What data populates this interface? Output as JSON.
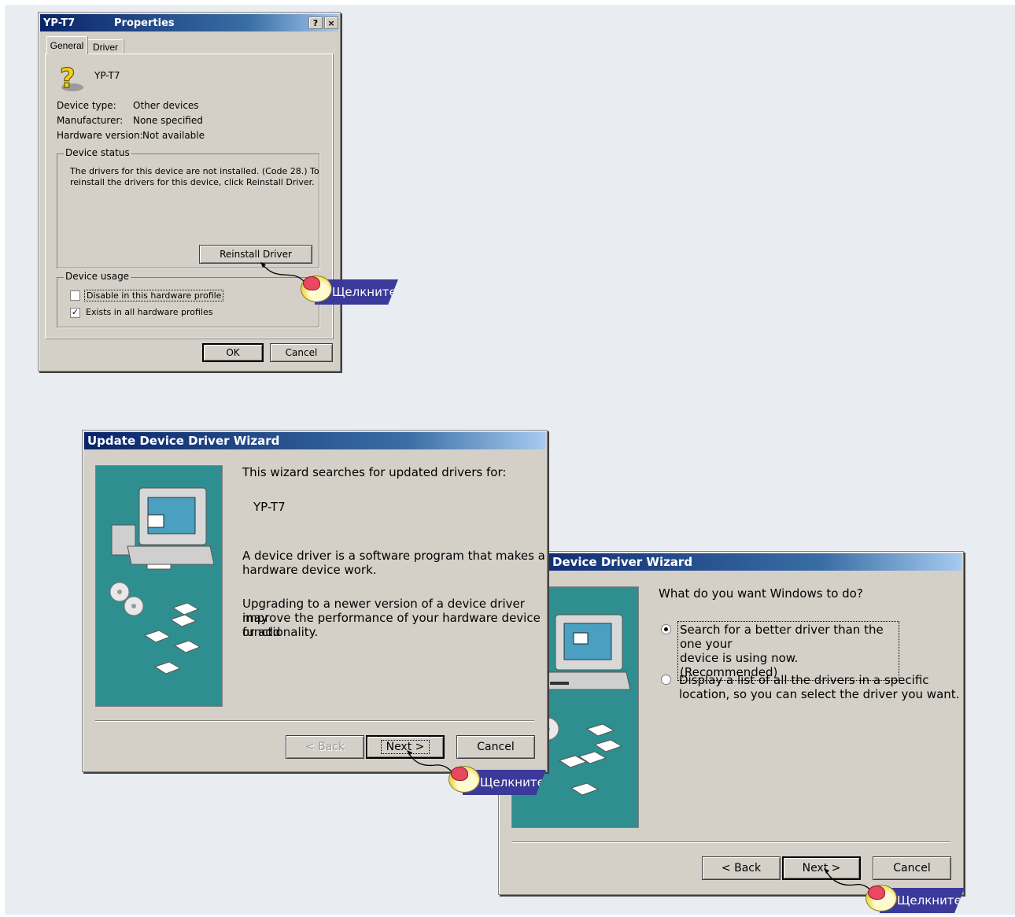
{
  "properties_dialog": {
    "title_left": "YP-T7",
    "title_right": "Properties",
    "help_btn": "?",
    "close_btn": "×",
    "tabs": [
      "General",
      "Driver"
    ],
    "device_name": "YP-T7",
    "rows": [
      {
        "label": "Device type:",
        "value": "Other devices"
      },
      {
        "label": "Manufacturer:",
        "value": "None specified"
      },
      {
        "label": "Hardware version:",
        "value": "Not available"
      }
    ],
    "status_group": "Device status",
    "status_text_1": "The drivers for this device are not installed. (Code 28.) To",
    "status_text_2": "reinstall the drivers for this device, click Reinstall Driver.",
    "reinstall_button": "Reinstall Driver",
    "usage_group": "Device usage",
    "usage_options": [
      {
        "label": "Disable in this hardware profile",
        "checked": false
      },
      {
        "label": "Exists in all hardware profiles",
        "checked": true
      }
    ],
    "ok_button": "OK",
    "cancel_button": "Cancel"
  },
  "wizard1": {
    "title": "Update Device Driver Wizard",
    "line1": "This wizard searches for updated drivers for:",
    "device": "YP-T7",
    "para1_a": "A device driver is a software program that makes a",
    "para1_b": "hardware device work.",
    "para2_a": "Upgrading to a newer version of a device driver may",
    "para2_b": "improve the performance of your hardware device or add",
    "para2_c": "functionality.",
    "back_button": "< Back",
    "next_button": "Next >",
    "cancel_button": "Cancel"
  },
  "wizard2": {
    "title": "Device Driver Wizard",
    "question": "What do you want Windows to do?",
    "option1_a": "Search for a better driver than the one your",
    "option1_b": "device is using now. (Recommended)",
    "option1_selected": true,
    "option2_a": "Display a list of all the drivers in a specific",
    "option2_b": "location, so you can select the driver you want.",
    "back_button": "< Back",
    "next_button": "Next >",
    "cancel_button": "Cancel"
  },
  "callouts": [
    "Щелкните",
    "Щелкните",
    "Щелкните"
  ],
  "colors": {
    "titlebar": "#0a246a",
    "dialog": "#d4d0c8",
    "panel": "#2f8e8f",
    "callout": "#3b3a9a"
  }
}
